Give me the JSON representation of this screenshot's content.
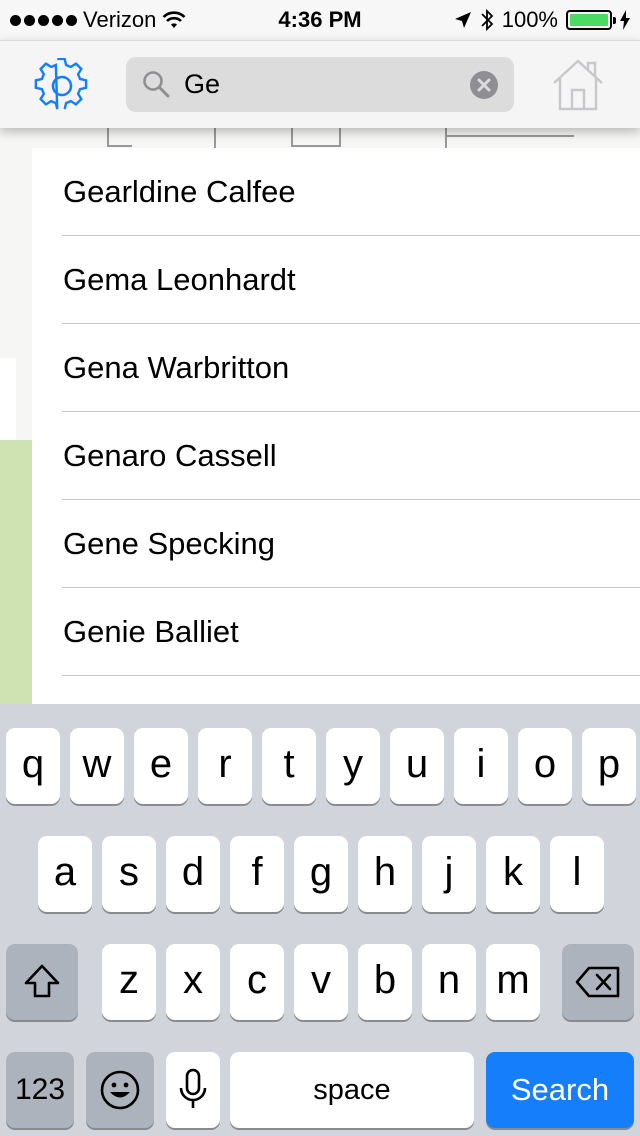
{
  "status_bar": {
    "carrier": "Verizon",
    "time": "4:36 PM",
    "battery": "100%"
  },
  "nav": {
    "search_value": "Ge",
    "search_placeholder": "Search"
  },
  "results": [
    "Gearldine Calfee",
    "Gema Leonhardt",
    "Gena Warbritton",
    "Genaro Cassell",
    "Gene Specking",
    "Genie Balliet"
  ],
  "keyboard": {
    "row1": [
      "q",
      "w",
      "e",
      "r",
      "t",
      "y",
      "u",
      "i",
      "o",
      "p"
    ],
    "row2": [
      "a",
      "s",
      "d",
      "f",
      "g",
      "h",
      "j",
      "k",
      "l"
    ],
    "row3": [
      "z",
      "x",
      "c",
      "v",
      "b",
      "n",
      "m"
    ],
    "numbers_label": "123",
    "space_label": "space",
    "search_label": "Search"
  },
  "colors": {
    "accent": "#157efb",
    "battery": "#4cd964",
    "map_green": "#cfe3b2"
  }
}
